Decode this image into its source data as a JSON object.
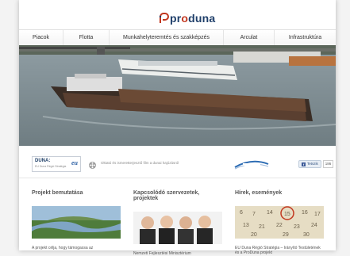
{
  "logo": {
    "brand_prefix": "pr",
    "brand_o": "o",
    "brand_suffix": "duna"
  },
  "nav": {
    "items": [
      {
        "label": "Piacok"
      },
      {
        "label": "Flotta"
      },
      {
        "label": "Munkahelyteremtés és szakképzés"
      },
      {
        "label": "Arculat"
      },
      {
        "label": "Infrastruktúra"
      }
    ]
  },
  "strip": {
    "duna_logo_title": "DUNA:",
    "duna_logo_sub": "EU Duna Régió Stratégia",
    "duna_logo_eu": "eu",
    "text": "Oktató és ismeretterjesztő film a dunai hajózásról",
    "tweet_label": "Tetszik",
    "tweet_count": "186"
  },
  "columns": [
    {
      "title": "Projekt bemutatása",
      "text": "A projekt célja, hogy támogassa az"
    },
    {
      "title": "Kapcsolódó szervezetek, projektek",
      "text": "Nemzeti Fejlesztési Minisztérium"
    },
    {
      "title": "Hírek, események",
      "text": "EU Duna Régió Stratégia – Irányító Testületének és a ProDuna projekt"
    }
  ],
  "colors": {
    "accent": "#c2371f",
    "brand": "#1f3f6a"
  }
}
